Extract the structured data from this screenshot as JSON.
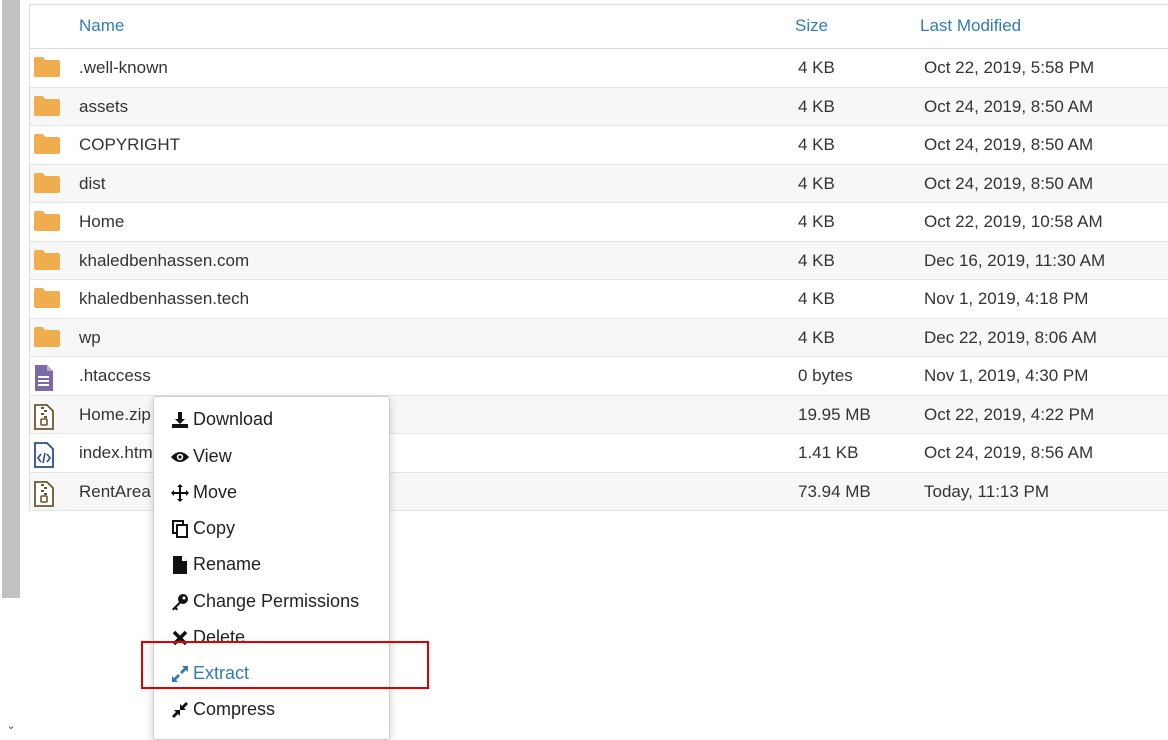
{
  "table": {
    "headers": {
      "name": "Name",
      "size": "Size",
      "modified": "Last Modified"
    },
    "rows": [
      {
        "type": "folder",
        "name": ".well-known",
        "size": "4 KB",
        "modified": "Oct 22, 2019, 5:58 PM"
      },
      {
        "type": "folder",
        "name": "assets",
        "size": "4 KB",
        "modified": "Oct 24, 2019, 8:50 AM"
      },
      {
        "type": "folder",
        "name": "COPYRIGHT",
        "size": "4 KB",
        "modified": "Oct 24, 2019, 8:50 AM"
      },
      {
        "type": "folder",
        "name": "dist",
        "size": "4 KB",
        "modified": "Oct 24, 2019, 8:50 AM"
      },
      {
        "type": "folder",
        "name": "Home",
        "size": "4 KB",
        "modified": "Oct 22, 2019, 10:58 AM"
      },
      {
        "type": "folder",
        "name": "khaledbenhassen.com",
        "size": "4 KB",
        "modified": "Dec 16, 2019, 11:30 AM"
      },
      {
        "type": "folder",
        "name": "khaledbenhassen.tech",
        "size": "4 KB",
        "modified": "Nov 1, 2019, 4:18 PM"
      },
      {
        "type": "folder",
        "name": "wp",
        "size": "4 KB",
        "modified": "Dec 22, 2019, 8:06 AM"
      },
      {
        "type": "text",
        "name": ".htaccess",
        "size": "0 bytes",
        "modified": "Nov 1, 2019, 4:30 PM"
      },
      {
        "type": "zip",
        "name": "Home.zip",
        "size": "19.95 MB",
        "modified": "Oct 22, 2019, 4:22 PM"
      },
      {
        "type": "code",
        "name": "index.htm",
        "size": "1.41 KB",
        "modified": "Oct 24, 2019, 8:56 AM"
      },
      {
        "type": "zip",
        "name": "RentArea",
        "size": "73.94 MB",
        "modified": "Today, 11:13 PM"
      }
    ]
  },
  "context_menu": {
    "items": [
      {
        "label": "Download",
        "icon": "download-icon"
      },
      {
        "label": "View",
        "icon": "eye-icon"
      },
      {
        "label": "Move",
        "icon": "move-arrows-icon"
      },
      {
        "label": "Copy",
        "icon": "copy-icon"
      },
      {
        "label": "Rename",
        "icon": "file-icon"
      },
      {
        "label": "Change Permissions",
        "icon": "key-icon"
      },
      {
        "label": "Delete",
        "icon": "x-icon"
      },
      {
        "label": "Extract",
        "icon": "expand-icon"
      },
      {
        "label": "Compress",
        "icon": "compress-icon"
      }
    ],
    "highlighted": "Extract"
  },
  "colors": {
    "link": "#337ab7",
    "folder": "#f0ad4e",
    "file_icon": "#7b6aa8",
    "highlight": "#e00000"
  }
}
